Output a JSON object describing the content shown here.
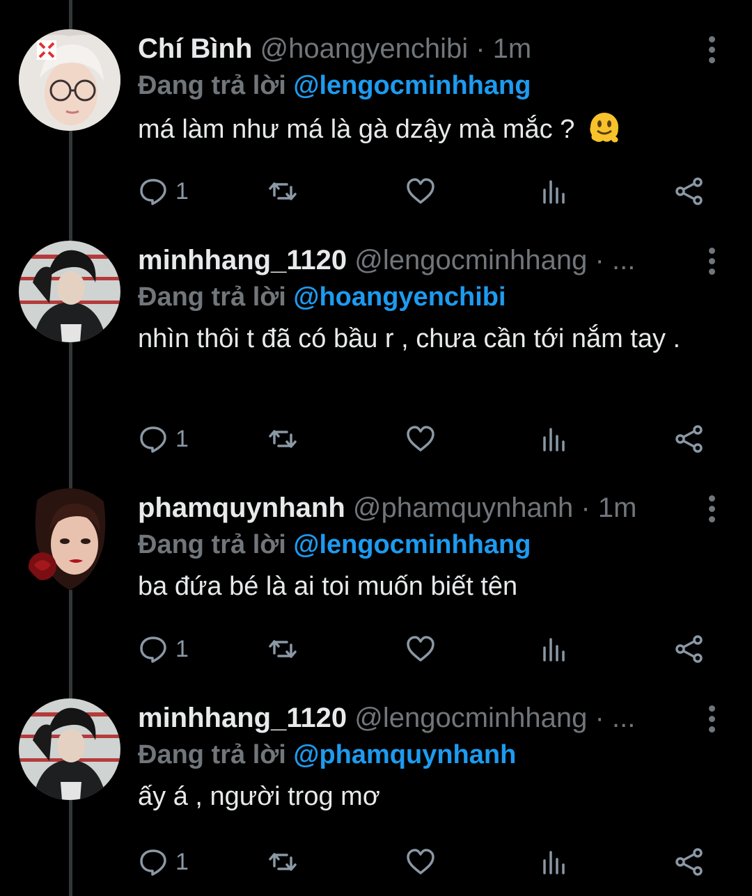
{
  "tweets": [
    {
      "name": "Chí Bình",
      "handle": "@hoangyenchibi",
      "meta": " · 1m",
      "reply_prefix": "Đang trả lời ",
      "reply_to": "@lengocminhhang",
      "text": "má làm như má là gà dzậy mà mắc ?",
      "emoji": "melting-face",
      "reply_count": "1"
    },
    {
      "name": "minhhang_1120",
      "handle": "@lengocminhhang",
      "meta": " · ...",
      "reply_prefix": "Đang trả lời ",
      "reply_to": "@hoangyenchibi",
      "text": "nhìn thôi t đã có bầu r , chưa cần tới nắm tay .",
      "reply_count": "1"
    },
    {
      "name": "phamquynhanh",
      "handle": "@phamquynhanh",
      "meta": " · 1m",
      "reply_prefix": "Đang trả lời ",
      "reply_to": "@lengocminhhang",
      "text": "ba đứa bé là ai toi muốn biết tên",
      "reply_count": "1"
    },
    {
      "name": "minhhang_1120",
      "handle": "@lengocminhhang",
      "meta": " · ...",
      "reply_prefix": "Đang trả lời ",
      "reply_to": "@phamquynhanh",
      "text": "ấy á , người trog mơ",
      "reply_count": "1"
    }
  ],
  "colors": {
    "background": "#000000",
    "text": "#e7e9ea",
    "secondary": "#71767b",
    "mention": "#1d9bf0",
    "thread_line": "#333639"
  }
}
